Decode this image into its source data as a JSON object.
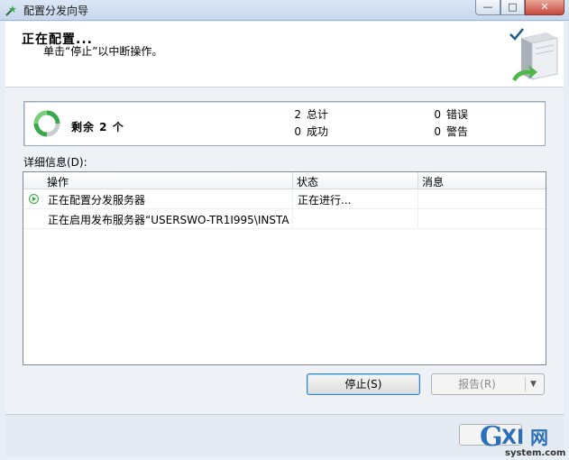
{
  "window": {
    "title": "配置分发向导",
    "icon": "wizard-icon"
  },
  "header": {
    "title": "正在配置...",
    "subtitle": "单击“停止”以中断操作。"
  },
  "summary": {
    "remaining_label": "剩余 2 个",
    "stats": [
      {
        "value": "2",
        "label": "总计"
      },
      {
        "value": "0",
        "label": "错误"
      },
      {
        "value": "0",
        "label": "成功"
      },
      {
        "value": "0",
        "label": "警告"
      }
    ]
  },
  "details": {
    "label": "详细信息(D):",
    "columns": [
      "操作",
      "状态",
      "消息"
    ],
    "rows": [
      {
        "action": "正在配置分发服务器",
        "status": "正在进行...",
        "message": "",
        "icon": "in-progress-icon"
      },
      {
        "action": "正在启用发布服务器“USERSWO-TR1I995\\INSTA...",
        "status": "",
        "message": ""
      }
    ]
  },
  "buttons": {
    "stop": "停止(S)",
    "report": "报告(R)"
  },
  "watermark": {
    "brand": "GXI网",
    "site": "system.com"
  },
  "colors": {
    "accent_green": "#3aa84a",
    "title_bar": "#c6d6ec"
  }
}
